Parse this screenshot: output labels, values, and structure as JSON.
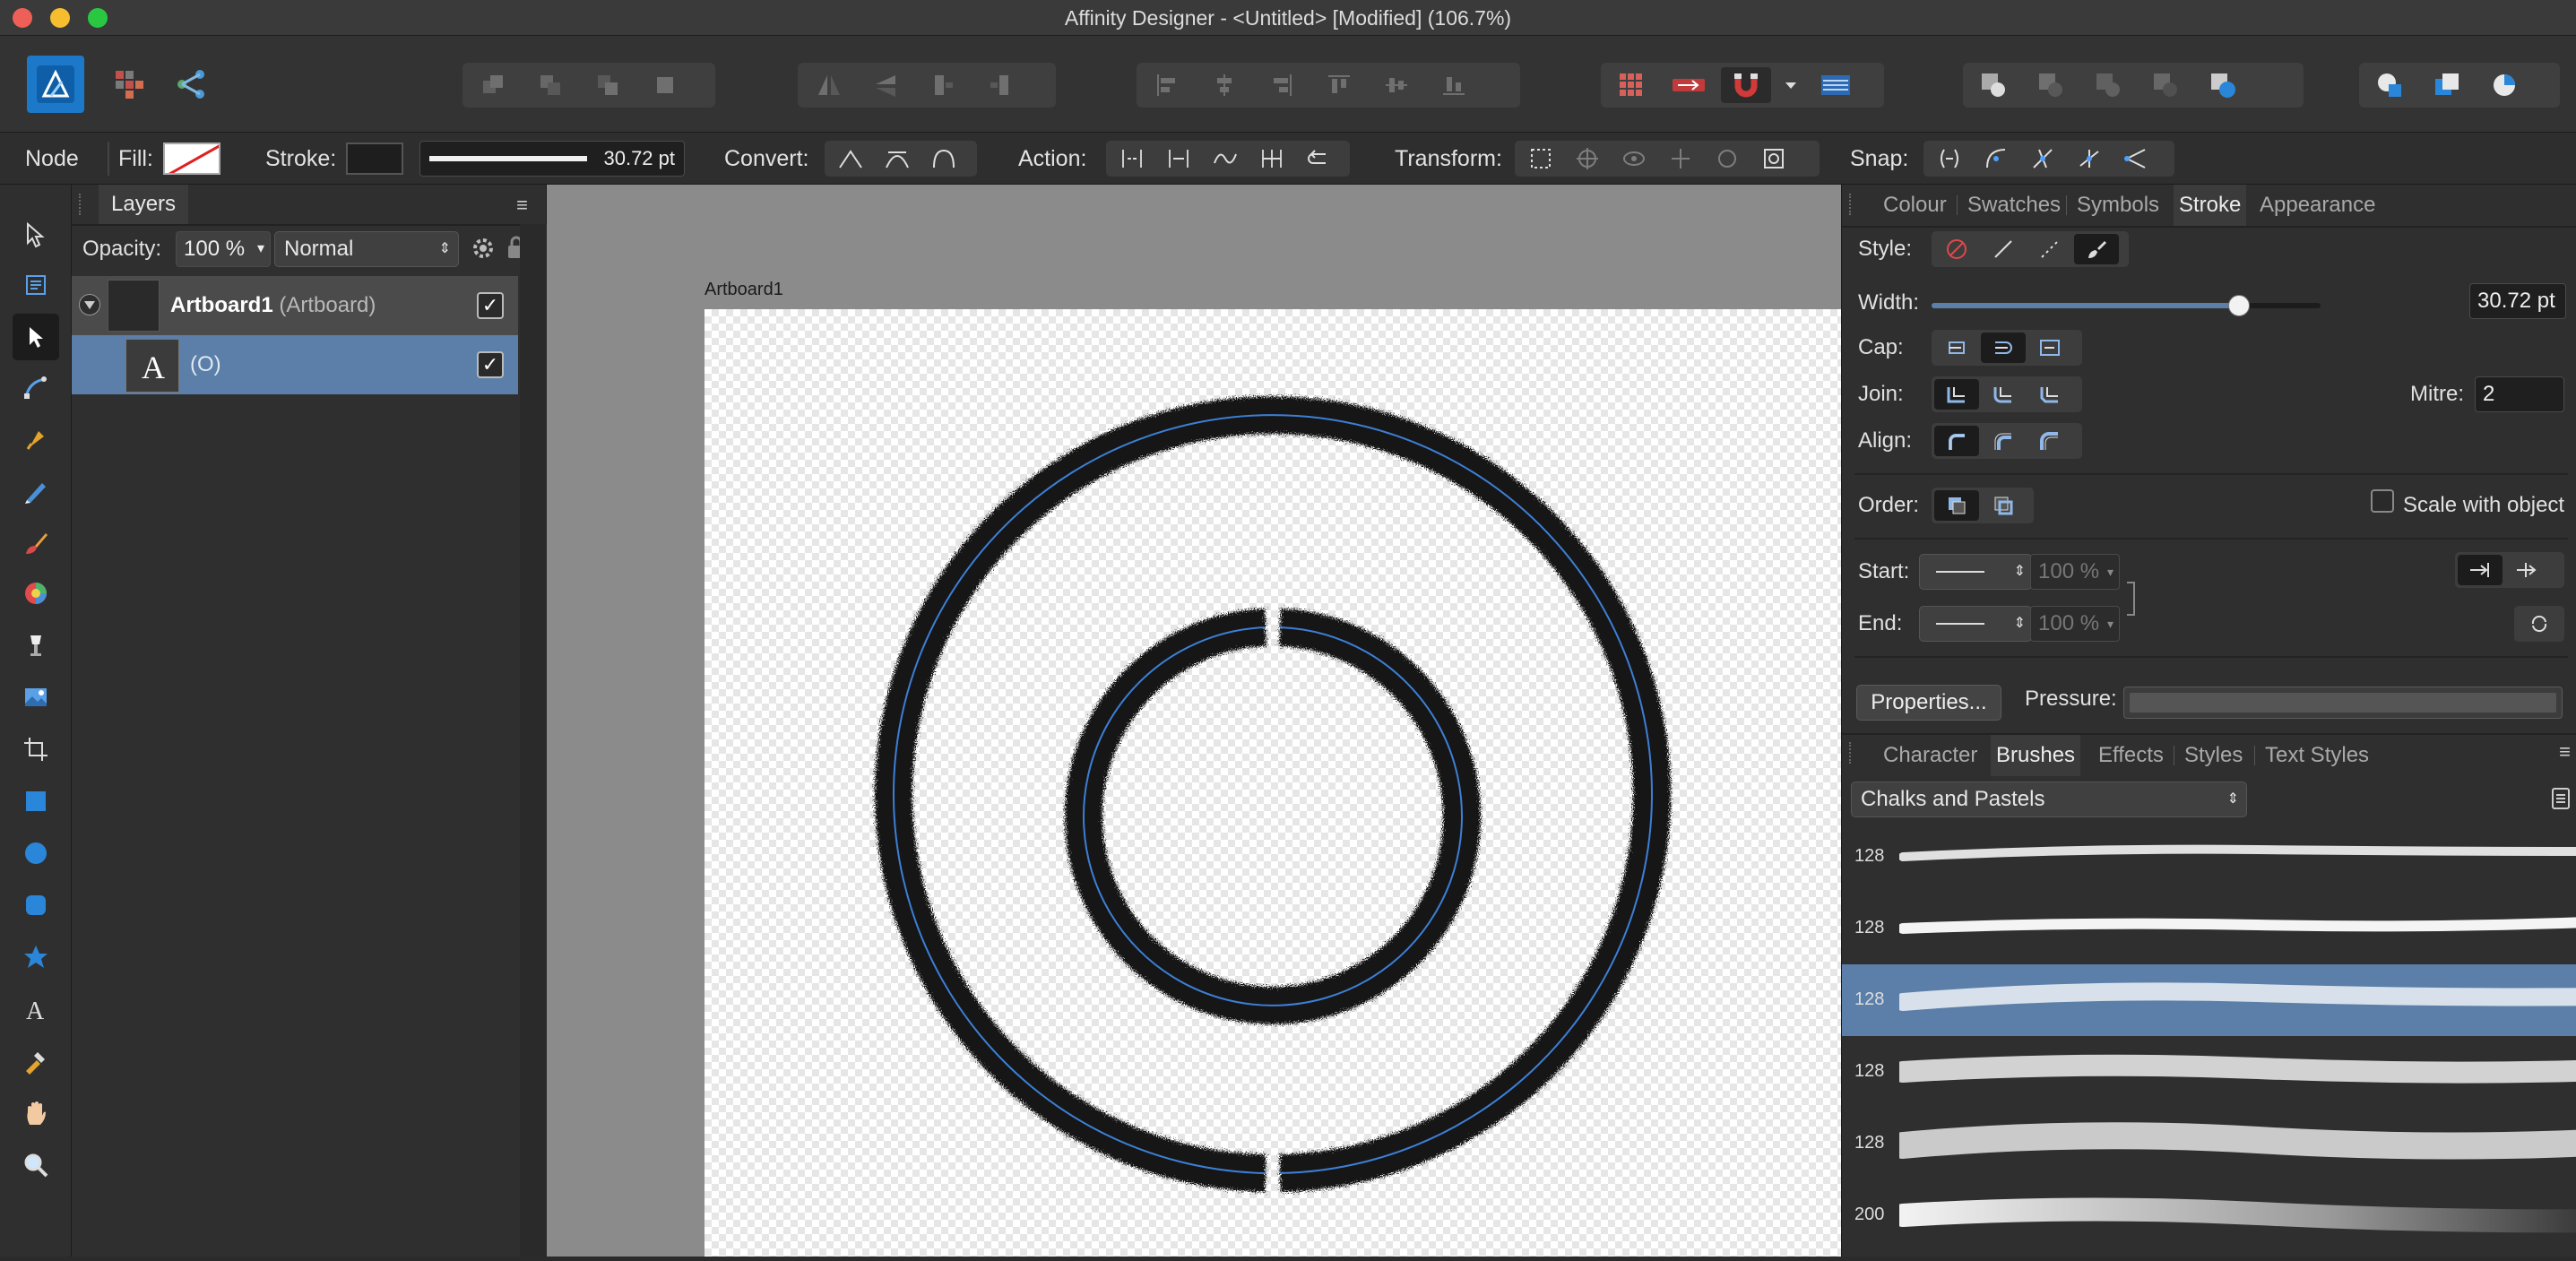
{
  "window": {
    "title": "Affinity Designer - <Untitled> [Modified] (106.7%)"
  },
  "context_toolbar": {
    "tool_name": "Node",
    "fill_label": "Fill:",
    "stroke_label": "Stroke:",
    "stroke_width": "30.72 pt",
    "convert_label": "Convert:",
    "action_label": "Action:",
    "transform_label": "Transform:",
    "snap_label": "Snap:"
  },
  "layers_panel": {
    "tab": "Layers",
    "opacity_label": "Opacity:",
    "opacity_value": "100 %",
    "blend_mode": "Normal",
    "layers": [
      {
        "name": "Artboard1",
        "type": "(Artboard)",
        "visible": true
      },
      {
        "name": "(O)",
        "type": "",
        "visible": true
      }
    ]
  },
  "canvas": {
    "artboard_label": "Artboard1"
  },
  "stroke_panel": {
    "tabs": [
      "Colour",
      "Swatches",
      "Symbols",
      "Stroke",
      "Appearance"
    ],
    "active_tab": "Stroke",
    "style_label": "Style:",
    "width_label": "Width:",
    "width_value": "30.72 pt",
    "width_fraction": 0.79,
    "cap_label": "Cap:",
    "join_label": "Join:",
    "mitre_label": "Mitre:",
    "mitre_value": "2",
    "align_label": "Align:",
    "order_label": "Order:",
    "scale_with_object": "Scale with object",
    "start_label": "Start:",
    "start_scale": "100 %",
    "end_label": "End:",
    "end_scale": "100 %",
    "properties_button": "Properties...",
    "pressure_label": "Pressure:"
  },
  "brushes_panel": {
    "tabs": [
      "Character",
      "Brushes",
      "Effects",
      "Styles",
      "Text Styles"
    ],
    "active_tab": "Brushes",
    "category": "Chalks and Pastels",
    "brushes": [
      {
        "size": "128",
        "selected": false
      },
      {
        "size": "128",
        "selected": false
      },
      {
        "size": "128",
        "selected": true
      },
      {
        "size": "128",
        "selected": false
      },
      {
        "size": "128",
        "selected": false
      },
      {
        "size": "200",
        "selected": false
      }
    ]
  },
  "colors": {
    "accent_blue": "#5b7fa8",
    "affinity_blue": "#1f8ad9",
    "selection_outline": "#3d7fd6"
  }
}
